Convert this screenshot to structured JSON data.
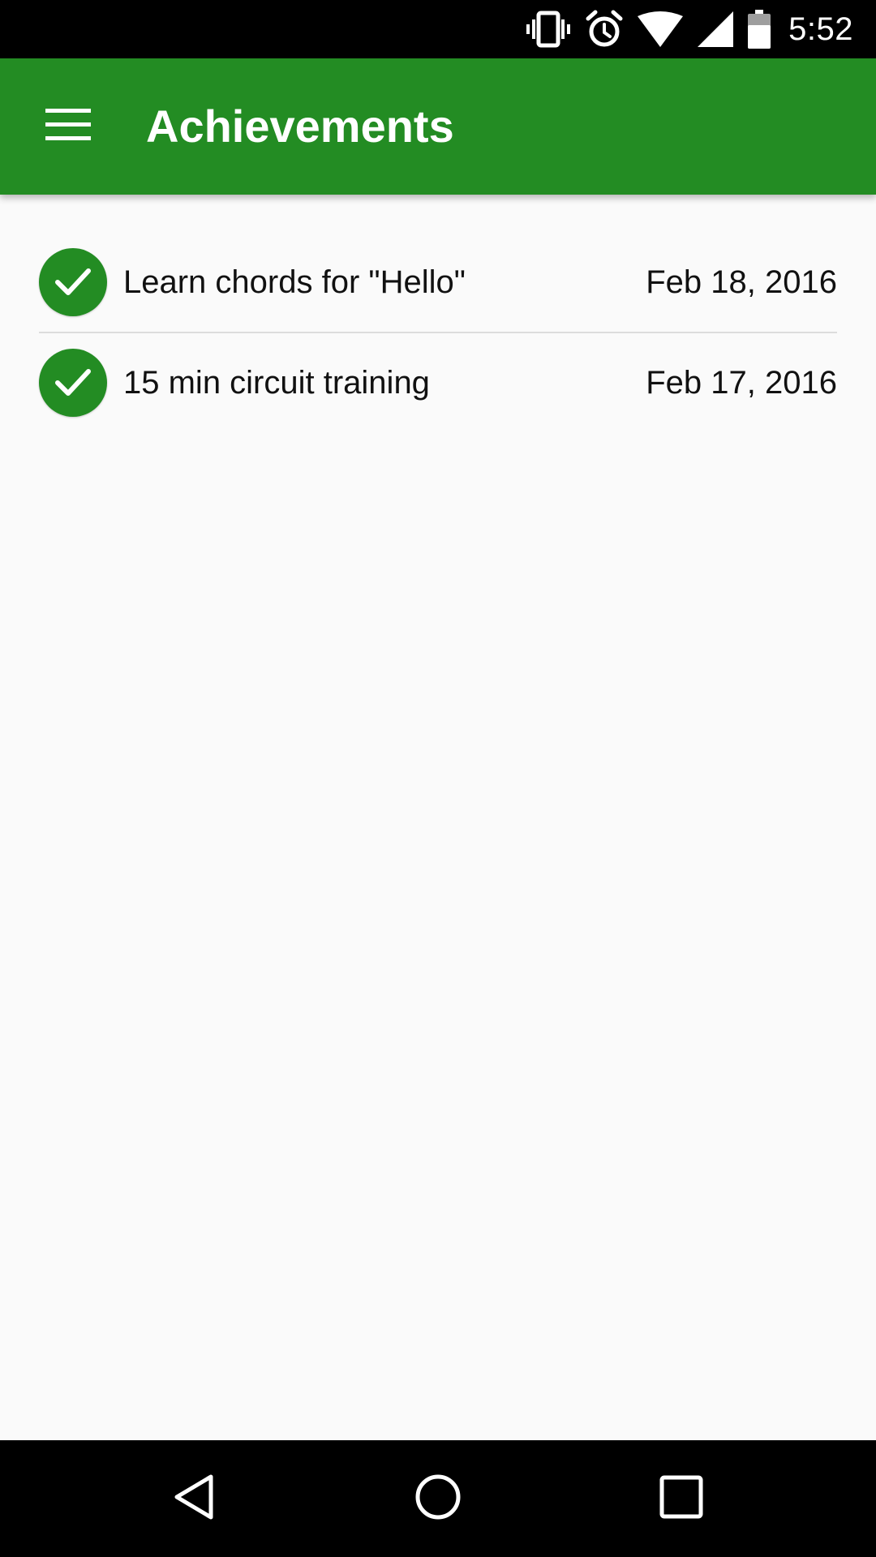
{
  "status_bar": {
    "time": "5:52",
    "icons": [
      "vibrate-icon",
      "alarm-icon",
      "wifi-icon",
      "signal-icon",
      "battery-icon"
    ]
  },
  "app_bar": {
    "title": "Achievements",
    "menu_icon": "hamburger-menu-icon"
  },
  "achievements": [
    {
      "title": "Learn chords for \"Hello\"",
      "date": "Feb 18, 2016",
      "icon": "check-circle-icon"
    },
    {
      "title": "15 min circuit training",
      "date": "Feb 17, 2016",
      "icon": "check-circle-icon"
    }
  ],
  "nav_bar": {
    "buttons": [
      "back-icon",
      "home-icon",
      "recents-icon"
    ]
  },
  "colors": {
    "primary": "#238c23",
    "status_bar": "#000000",
    "background": "#fafafa",
    "divider": "#dcdcdc",
    "text": "#111111"
  }
}
